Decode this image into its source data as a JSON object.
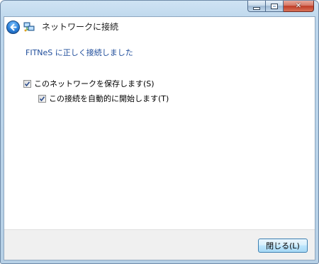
{
  "window": {
    "caption_buttons": {
      "minimize": "minimize-icon",
      "maximize": "maximize-icon",
      "close_glyph": "✕"
    }
  },
  "header": {
    "back_icon": "back-arrow-icon",
    "network_icon": "network-icon",
    "title": "ネットワークに接続"
  },
  "main": {
    "status_text": "FITNeS に正しく接続しました",
    "save_network": {
      "label": "このネットワークを保存します(S)",
      "checked": true
    },
    "auto_start": {
      "label": "この接続を自動的に開始します(T)",
      "checked": true
    }
  },
  "footer": {
    "close_label": "閉じる(L)"
  },
  "colors": {
    "accent_text": "#1e4c9a",
    "titlebar": "#bcd6ec",
    "close_caption": "#c94a34"
  }
}
